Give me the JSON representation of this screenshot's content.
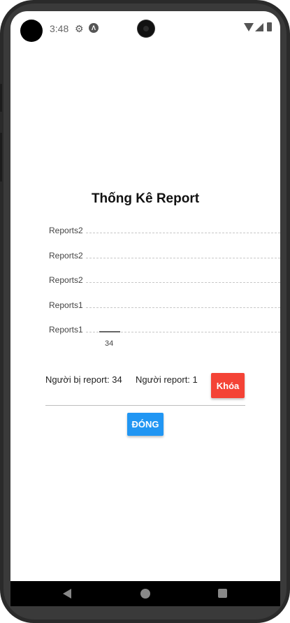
{
  "status_bar": {
    "time": "3:48",
    "icons": [
      "gear-icon",
      "android-debug-icon",
      "wifi-icon",
      "signal-icon",
      "battery-icon"
    ]
  },
  "title": "Thống Kê Report",
  "chart_data": {
    "type": "bar",
    "categories": [
      "34"
    ],
    "values": [
      1
    ],
    "y_tick_labels": [
      "Reports1",
      "Reports1",
      "Reports2",
      "Reports2",
      "Reports2"
    ],
    "grid": true
  },
  "info": {
    "reported_label": "Người bị report: 34",
    "reporter_label": "Người report: 1"
  },
  "buttons": {
    "lock": "Khóa",
    "close": "ĐÓNG"
  },
  "colors": {
    "lock": "#f44336",
    "close": "#2196f3"
  },
  "nav_icons": [
    "back-icon",
    "home-icon",
    "recents-icon"
  ]
}
